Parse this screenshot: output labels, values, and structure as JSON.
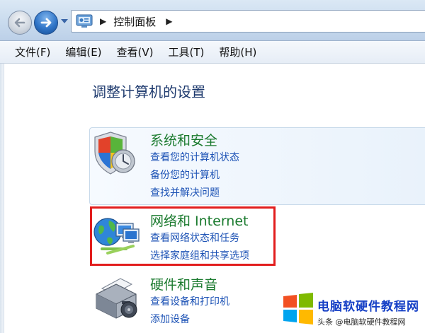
{
  "address_bar": {
    "breadcrumb": "控制面板"
  },
  "menu": {
    "items": [
      "文件(F)",
      "编辑(E)",
      "查看(V)",
      "工具(T)",
      "帮助(H)"
    ]
  },
  "page": {
    "title": "调整计算机的设置"
  },
  "categories": [
    {
      "title": "系统和安全",
      "icon": "shield-icon",
      "links": [
        "查看您的计算机状态",
        "备份您的计算机",
        "查找并解决问题"
      ]
    },
    {
      "title": "网络和 Internet",
      "icon": "network-globe-icon",
      "links": [
        "查看网络状态和任务",
        "选择家庭组和共享选项"
      ]
    },
    {
      "title": "硬件和声音",
      "icon": "printer-icon",
      "links": [
        "查看设备和打印机",
        "添加设备"
      ]
    }
  ],
  "watermark": {
    "logo": "windows-logo",
    "brand": "电脑软硬件教程网",
    "sub": "头条 @电脑软硬件教程网"
  },
  "colors": {
    "category_title": "#1a7a2e",
    "link": "#1c52b5",
    "page_title": "#1e3a6e",
    "highlight": "#e21d1d"
  }
}
